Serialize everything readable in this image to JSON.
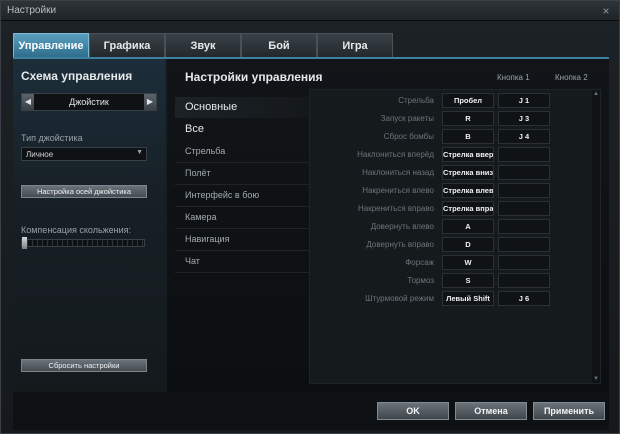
{
  "window": {
    "title": "Настройки",
    "close_glyph": "×"
  },
  "tabs": [
    {
      "label": "Управление",
      "active": true
    },
    {
      "label": "Графика",
      "active": false
    },
    {
      "label": "Звук",
      "active": false
    },
    {
      "label": "Бой",
      "active": false
    },
    {
      "label": "Игра",
      "active": false
    }
  ],
  "left": {
    "title": "Схема управления",
    "scheme_value": "Джойстик",
    "joystick_type_label": "Тип джойстика",
    "joystick_type_value": "Личное",
    "axis_setup_button": "Настройка осей джойстика",
    "slip_comp_label": "Компенсация скольжения:",
    "slip_comp_level": 0,
    "reset_button": "Сбросить настройки"
  },
  "main": {
    "title": "Настройки управления",
    "col1": "Кнопка 1",
    "col2": "Кнопка 2",
    "categories": [
      {
        "label": "Основные",
        "head": true,
        "selected": true
      },
      {
        "label": "Все",
        "head": true,
        "selected": false
      },
      {
        "label": "Стрельба",
        "head": false
      },
      {
        "label": "Полёт",
        "head": false
      },
      {
        "label": "Интерфейс в бою",
        "head": false
      },
      {
        "label": "Камера",
        "head": false
      },
      {
        "label": "Навигация",
        "head": false
      },
      {
        "label": "Чат",
        "head": false
      }
    ],
    "bindings": [
      {
        "action": "Стрельба",
        "key1": "Пробел",
        "key2": "J 1"
      },
      {
        "action": "Запуск ракеты",
        "key1": "R",
        "key2": "J 3"
      },
      {
        "action": "Сброс бомбы",
        "key1": "B",
        "key2": "J 4"
      },
      {
        "action": "Наклониться вперёд",
        "key1": "Стрелка вверх",
        "key2": ""
      },
      {
        "action": "Наклониться назад",
        "key1": "Стрелка вниз",
        "key2": ""
      },
      {
        "action": "Накрениться влево",
        "key1": "Стрелка влево",
        "key2": ""
      },
      {
        "action": "Накрениться вправо",
        "key1": "Стрелка вправо",
        "key2": ""
      },
      {
        "action": "Довернуть влево",
        "key1": "A",
        "key2": ""
      },
      {
        "action": "Довернуть вправо",
        "key1": "D",
        "key2": ""
      },
      {
        "action": "Форсаж",
        "key1": "W",
        "key2": ""
      },
      {
        "action": "Тормоз",
        "key1": "S",
        "key2": ""
      },
      {
        "action": "Штурмовой режим",
        "key1": "Левый Shift",
        "key2": "J 6"
      }
    ]
  },
  "footer": {
    "ok": "OK",
    "cancel": "Отмена",
    "apply": "Применить"
  },
  "icons": {
    "left_arrow": "left-arrow-icon",
    "right_arrow": "right-arrow-icon",
    "chevron": "chevron-down-icon",
    "close": "close-icon"
  },
  "colors": {
    "accent": "#3f7f9f",
    "tab_active": "#4a8fb0"
  }
}
